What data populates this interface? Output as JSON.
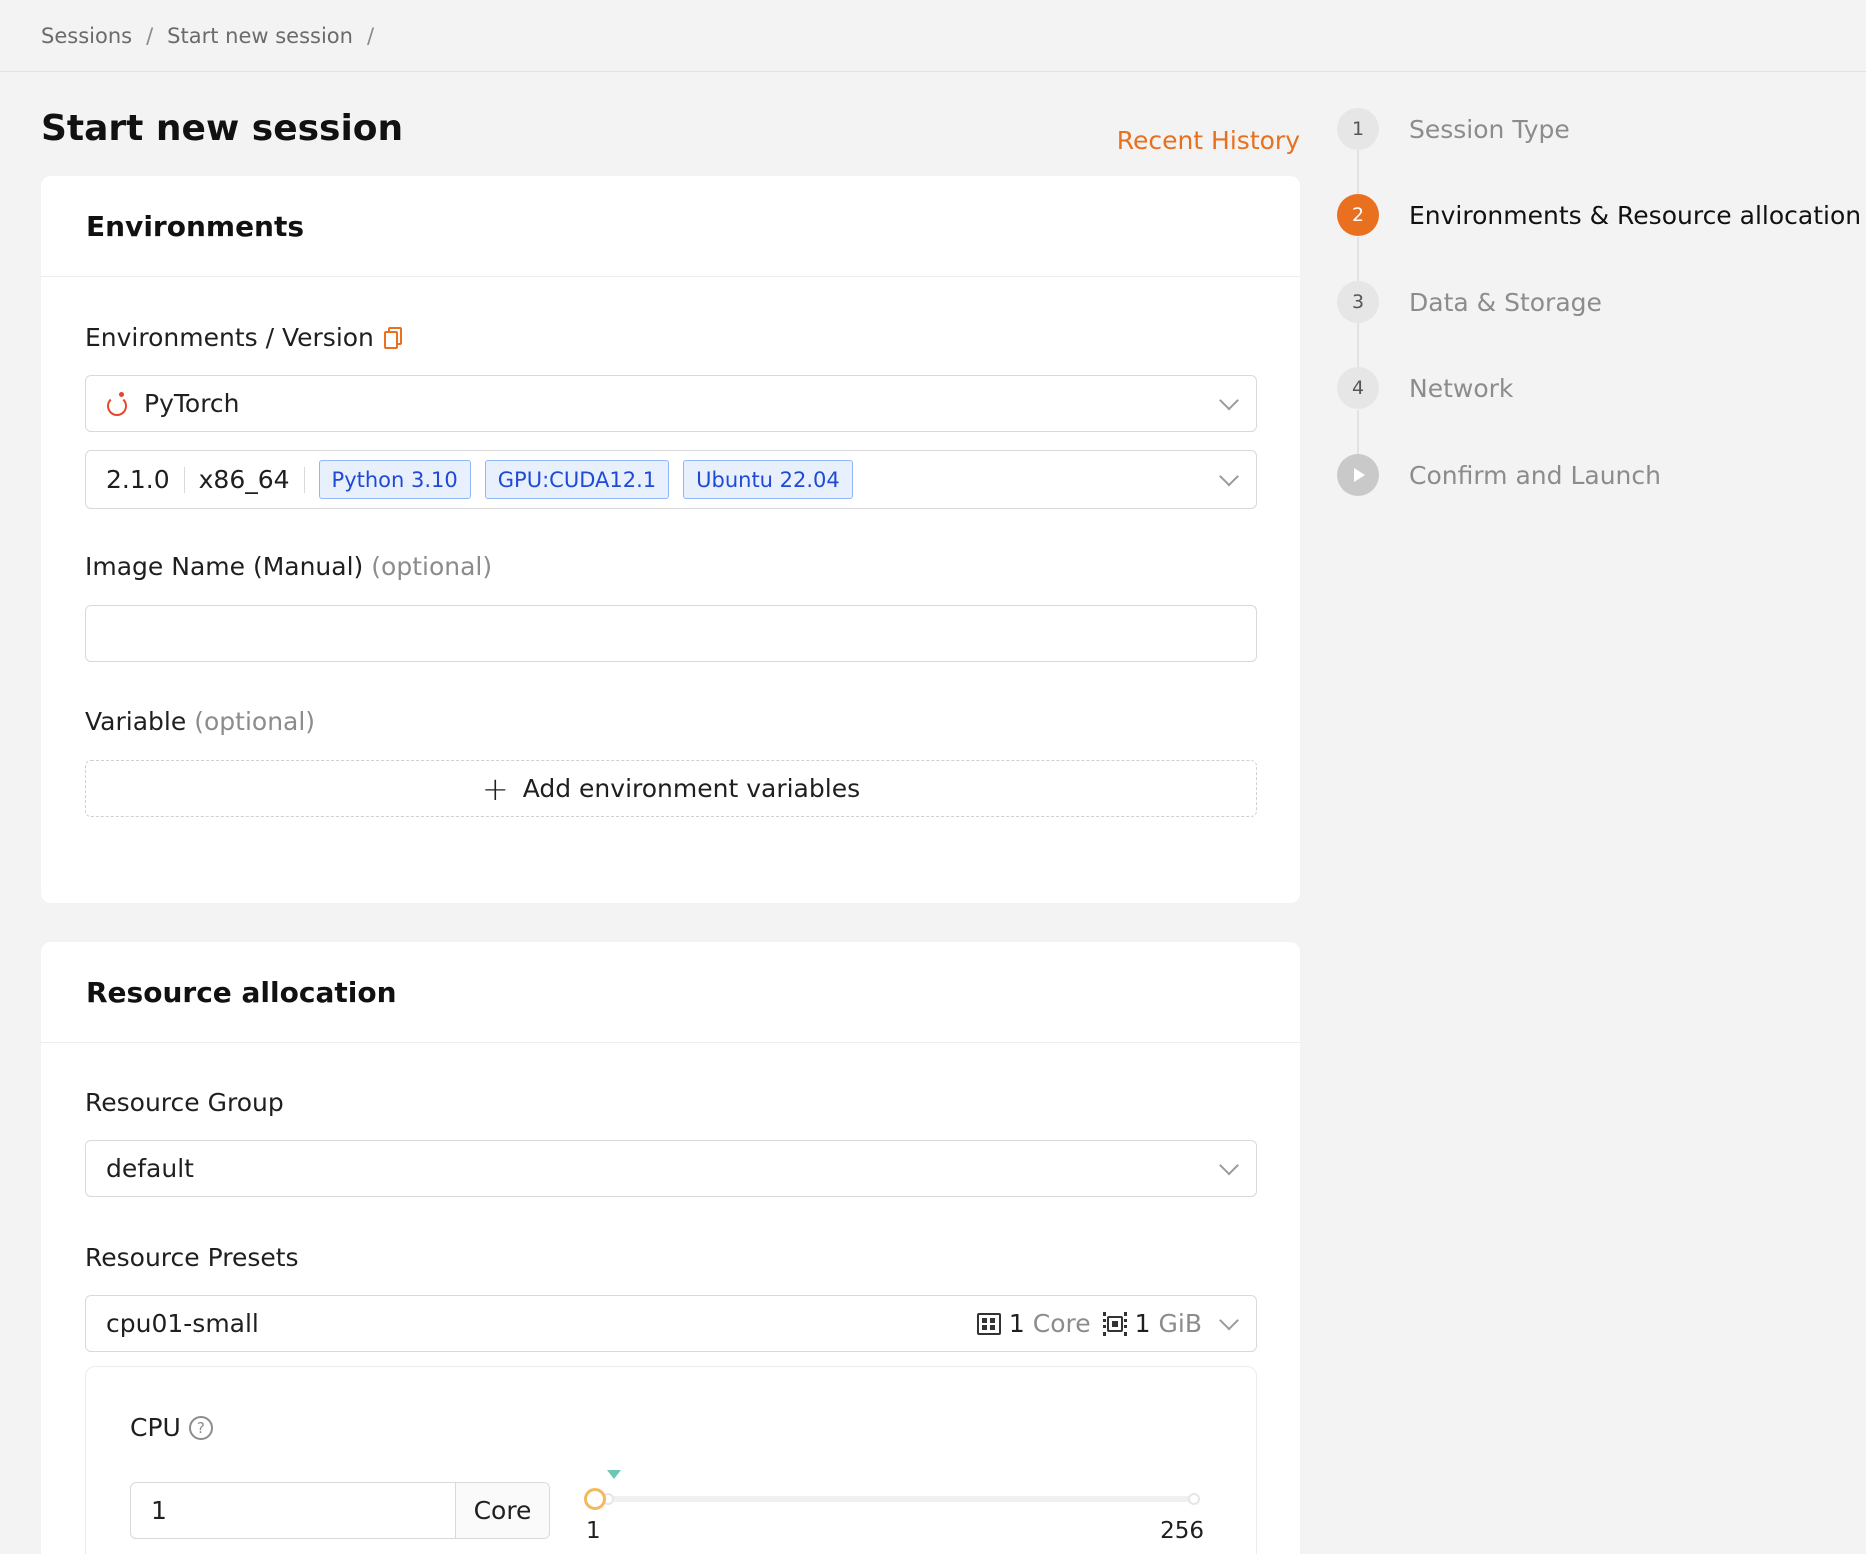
{
  "breadcrumb": {
    "items": [
      "Sessions",
      "Start new session"
    ]
  },
  "page": {
    "title": "Start new session",
    "recent_history": "Recent History"
  },
  "environments": {
    "title": "Environments",
    "env_version_label": "Environments / Version",
    "environment": "PyTorch",
    "version": "2.1.0",
    "arch": "x86_64",
    "tags": [
      "Python 3.10",
      "GPU:CUDA12.1",
      "Ubuntu 22.04"
    ],
    "image_name_label": "Image Name (Manual)",
    "image_name_value": "",
    "optional": "(optional)",
    "variable_label": "Variable",
    "add_env_button": "Add environment variables"
  },
  "resource": {
    "title": "Resource allocation",
    "group_label": "Resource Group",
    "group_value": "default",
    "presets_label": "Resource Presets",
    "preset_value": "cpu01-small",
    "preset_cpu_value": "1",
    "preset_cpu_unit": "Core",
    "preset_mem_value": "1",
    "preset_mem_unit": "GiB",
    "cpu": {
      "label": "CPU",
      "value": "1",
      "unit": "Core",
      "min": "1",
      "max": "256",
      "current": 1
    }
  },
  "steps": [
    {
      "num": "1",
      "label": "Session Type"
    },
    {
      "num": "2",
      "label": "Environments & Resource allocation"
    },
    {
      "num": "3",
      "label": "Data & Storage"
    },
    {
      "num": "4",
      "label": "Network"
    },
    {
      "num": "",
      "label": "Confirm and Launch"
    }
  ],
  "colors": {
    "accent": "#e8701f",
    "tag_text": "#1f4ad6",
    "tag_bg": "#e8f0fe"
  }
}
